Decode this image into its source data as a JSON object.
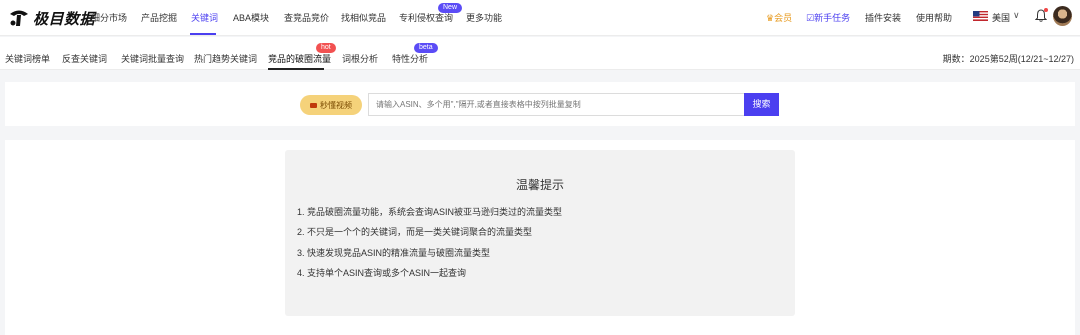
{
  "header": {
    "logo_text": "极目数据",
    "nav": [
      {
        "label": "细分市场"
      },
      {
        "label": "产品挖掘"
      },
      {
        "label": "关键词"
      },
      {
        "label": "ABA模块"
      },
      {
        "label": "查竞品竞价"
      },
      {
        "label": "找相似竞品"
      },
      {
        "label": "专利侵权查询"
      },
      {
        "label": "更多功能"
      }
    ],
    "active_nav": "关键词",
    "new_badge": "New",
    "vip_label": "会员",
    "task_label": "新手任务",
    "plugin_label": "插件安装",
    "help_label": "使用帮助",
    "country_label": "美国",
    "icons": [
      "logo-icon",
      "crown-icon",
      "checkbox-icon",
      "us-flag-icon",
      "chevron-down-icon",
      "bell-icon",
      "avatar"
    ]
  },
  "subnav": {
    "items": [
      {
        "label": "关键词榜单"
      },
      {
        "label": "反查关键词"
      },
      {
        "label": "关键词批量查询"
      },
      {
        "label": "热门趋势关键词"
      },
      {
        "label": "竞品的破圈流量"
      },
      {
        "label": "词根分析"
      },
      {
        "label": "特性分析"
      }
    ],
    "active_item": "竞品的破圈流量",
    "hot_badge": "hot",
    "beta_badge": "beta",
    "period_label": "期数：2025第52周(12/21~12/27)"
  },
  "search": {
    "video_label": "秒懂视频",
    "placeholder": "请输入ASIN、多个用\",\"隔开,或者直接表格中按列批量复制",
    "button_label": "搜索"
  },
  "tips": {
    "title": "温馨提示",
    "items": [
      "1. 竞品破圈流量功能，系统会查询ASIN被亚马逊归类过的流量类型",
      "2. 不只是一个个的关键词，而是一类关键词聚合的流量类型",
      "3. 快速发现竞品ASIN的精准流量与破圈流量类型",
      "4. 支持单个ASIN查询或多个ASIN一起查询"
    ]
  },
  "colors": {
    "accent": "#4b3ff0",
    "vip": "#e79a1f",
    "hot": "#f25151",
    "video_btn": "#f5d27a"
  }
}
